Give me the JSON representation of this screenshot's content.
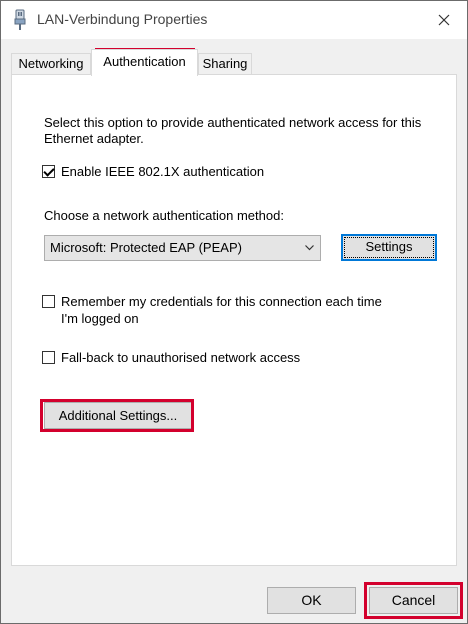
{
  "window": {
    "title": "LAN-Verbindung Properties"
  },
  "tabs": [
    {
      "label": "Networking"
    },
    {
      "label": "Authentication"
    },
    {
      "label": "Sharing"
    }
  ],
  "auth": {
    "description": "Select this option to provide authenticated network access for this Ethernet adapter.",
    "enable_8021x": {
      "label": "Enable IEEE 802.1X authentication",
      "checked": true
    },
    "method_label": "Choose a network authentication method:",
    "method_selected": "Microsoft: Protected EAP (PEAP)",
    "settings_label": "Settings",
    "remember": {
      "label": "Remember my credentials for this connection each time I'm logged on",
      "checked": false
    },
    "fallback": {
      "label": "Fall-back to unauthorised network access",
      "checked": false
    },
    "additional_label": "Additional Settings..."
  },
  "footer": {
    "ok_label": "OK",
    "cancel_label": "Cancel"
  },
  "colors": {
    "highlight_border": "#d3002d",
    "focus_blue": "#0078d7"
  },
  "icons": {
    "title": "network-adapter-icon",
    "close": "close-icon",
    "dropdown": "chevron-down-icon"
  }
}
